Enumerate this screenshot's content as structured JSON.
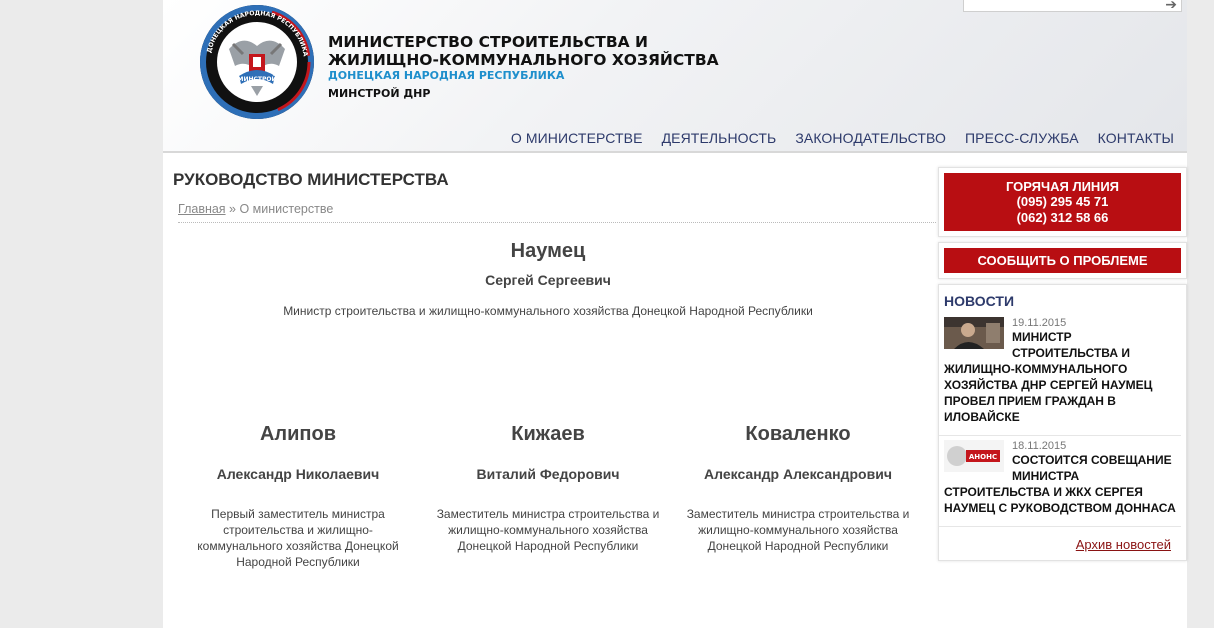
{
  "header": {
    "org_title_line1": "МИНИСТЕРСТВО СТРОИТЕЛЬСТВА И",
    "org_title_line2": "ЖИЛИЩНО-КОММУНАЛЬНОГО ХОЗЯЙСТВА",
    "org_subtitle": "ДОНЕЦКАЯ НАРОДНАЯ РЕСПУБЛИКА",
    "org_short": "МИНСТРОЙ ДНР",
    "emblem_ring_text": "ДОНЕЦКАЯ НАРОДНАЯ РЕСПУБЛИКА",
    "emblem_ribbon": "МИНСТРОЙ",
    "search_placeholder": "",
    "search_button": "➔"
  },
  "nav": [
    "О МИНИСТЕРСТВЕ",
    "ДЕЯТЕЛЬНОСТЬ",
    "ЗАКОНОДАТЕЛЬСТВО",
    "ПРЕСС-СЛУЖБА",
    "КОНТАКТЫ"
  ],
  "main": {
    "title": "РУКОВОДСТВО МИНИСТЕРСТВА",
    "breadcrumb_home": "Главная",
    "breadcrumb_sep": " » ",
    "breadcrumb_current": "О министерстве"
  },
  "minister": {
    "surname": "Наумец",
    "given": "Сергей Сергеевич",
    "role": "Министр строительства и жилищно-коммунального хозяйства Донецкой Народной Республики"
  },
  "deputies": [
    {
      "surname": "Алипов",
      "given": "Александр Николаевич",
      "role": "Первый заместитель министра строительства и жилищно-коммунального хозяйства Донецкой Народной Республики"
    },
    {
      "surname": "Кижаев",
      "given": "Виталий Федорович",
      "role": "Заместитель министра строительства и жилищно-коммунального хозяйства Донецкой Народной Республики"
    },
    {
      "surname": "Коваленко",
      "given": "Александр Александрович",
      "role": "Заместитель министра строительства и жилищно-коммунального хозяйства Донецкой Народной Республики"
    }
  ],
  "sidebar": {
    "hotline_title": "ГОРЯЧАЯ ЛИНИЯ",
    "phone1": "(095) 295 45 71",
    "phone2": "(062) 312 58 66",
    "report_button": "СООБЩИТЬ О ПРОБЛЕМЕ",
    "news_title": "НОВОСТИ",
    "news": [
      {
        "date": "19.11.2015",
        "text": "МИНИСТР СТРОИТЕЛЬСТВА И ЖИЛИЩНО-КОММУНАЛЬНОГО ХОЗЯЙСТВА ДНР СЕРГЕЙ НАУМЕЦ ПРОВЕЛ ПРИЕМ ГРАЖДАН В ИЛОВАЙСКЕ"
      },
      {
        "date": "18.11.2015",
        "text": "СОСТОИТСЯ СОВЕЩАНИЕ МИНИСТРА СТРОИТЕЛЬСТВА И ЖКХ СЕРГЕЯ НАУМЕЦ С РУКОВОДСТВОМ ДОННАСА",
        "thumb_label": "АНОНС"
      }
    ],
    "archive_link": "Архив новостей"
  },
  "colors": {
    "accent_red": "#b80e12",
    "nav_blue": "#2d3a6b",
    "subtitle_blue": "#1f8fcc"
  }
}
